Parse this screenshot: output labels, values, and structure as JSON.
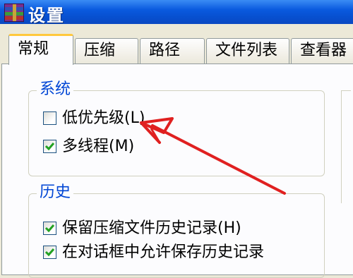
{
  "window": {
    "title": "设置",
    "icon": "winrar-books-icon"
  },
  "tabs": [
    {
      "label": "常规",
      "active": true
    },
    {
      "label": "压缩",
      "active": false
    },
    {
      "label": "路径",
      "active": false
    },
    {
      "label": "文件列表",
      "active": false
    },
    {
      "label": "查看器",
      "active": false
    }
  ],
  "system_group": {
    "label": "系统",
    "options": [
      {
        "label": "低优先级(L)",
        "checked": false
      },
      {
        "label": "多线程(M)",
        "checked": true
      }
    ]
  },
  "history_group": {
    "label": "历史",
    "options": [
      {
        "label": "保留压缩文件历史记录(H)",
        "checked": true
      },
      {
        "label": "在对话框中允许保存历史记录",
        "checked": true
      }
    ]
  },
  "annotation": {
    "arrow_color": "#e02020"
  },
  "colors": {
    "titlebar": "#0a5adf",
    "group_label": "#0046d5",
    "active_tab_accent": "#ffc83d"
  }
}
